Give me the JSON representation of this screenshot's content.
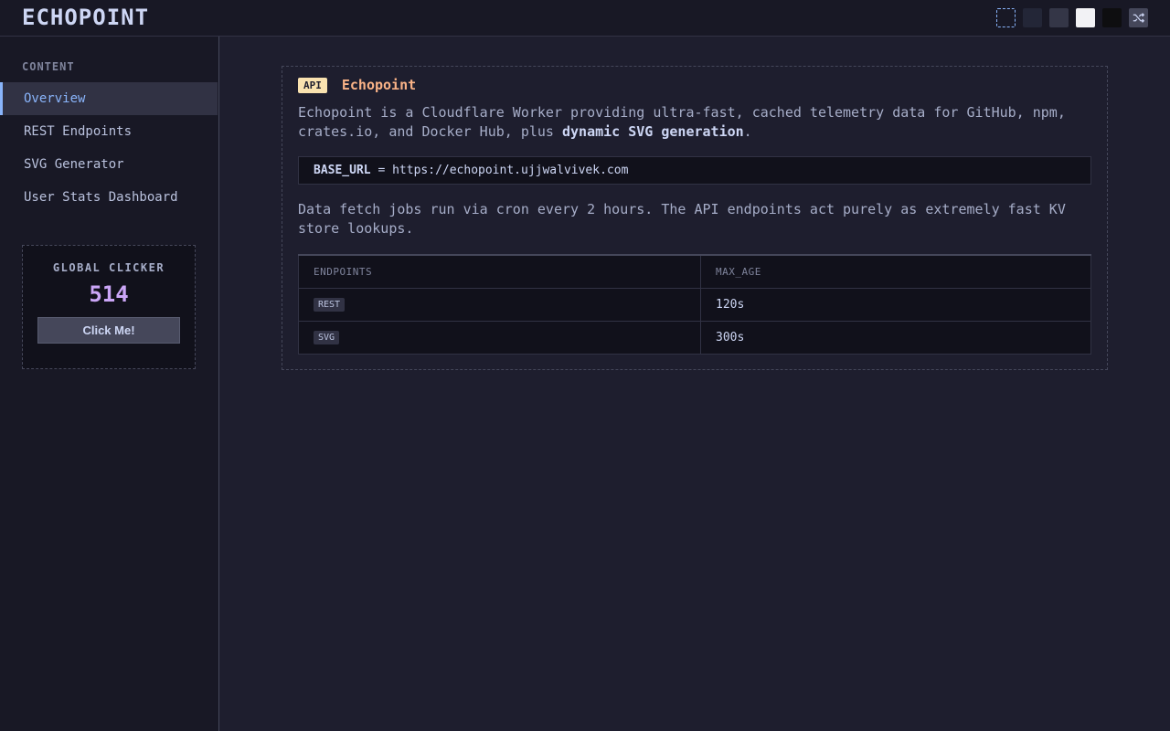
{
  "header": {
    "logo": "ECHOPOINT",
    "theme_swatches": [
      {
        "name": "theme-outline",
        "color": "transparent"
      },
      {
        "name": "theme-navy",
        "color": "#232637"
      },
      {
        "name": "theme-slate",
        "color": "#343647"
      },
      {
        "name": "theme-light",
        "color": "#f2f2f5"
      },
      {
        "name": "theme-black",
        "color": "#0e0e10"
      }
    ],
    "shuffle_icon": "shuffle-icon"
  },
  "sidebar": {
    "heading": "CONTENT",
    "items": [
      {
        "label": "Overview",
        "active": true
      },
      {
        "label": "REST Endpoints",
        "active": false
      },
      {
        "label": "SVG Generator",
        "active": false
      },
      {
        "label": "User Stats Dashboard",
        "active": false
      }
    ],
    "clicker": {
      "title": "GLOBAL CLICKER",
      "count": "514",
      "button_label": "Click Me!"
    }
  },
  "main": {
    "badge": "API",
    "title": "Echopoint",
    "intro_prefix": "Echopoint is a Cloudflare Worker providing ultra-fast, cached telemetry data for GitHub, npm, crates.io, and Docker Hub, plus ",
    "intro_bold": "dynamic SVG generation",
    "intro_suffix": ".",
    "base_url_key": "BASE_URL",
    "base_url_eq": " = ",
    "base_url_value": "https://echopoint.ujjwalvivek.com",
    "cron_text": "Data fetch jobs run via cron every 2 hours. The API endpoints act purely as extremely fast KV store lookups.",
    "table": {
      "headers": [
        "ENDPOINTS",
        "MAX_AGE"
      ],
      "rows": [
        {
          "endpoint": "REST",
          "max_age": "120s"
        },
        {
          "endpoint": "SVG",
          "max_age": "300s"
        }
      ]
    }
  },
  "colors": {
    "background": "#1e1e2e",
    "accent": "#89b4fa",
    "badge": "#f9e2af",
    "title": "#fab387",
    "counter": "#cba6f7"
  }
}
